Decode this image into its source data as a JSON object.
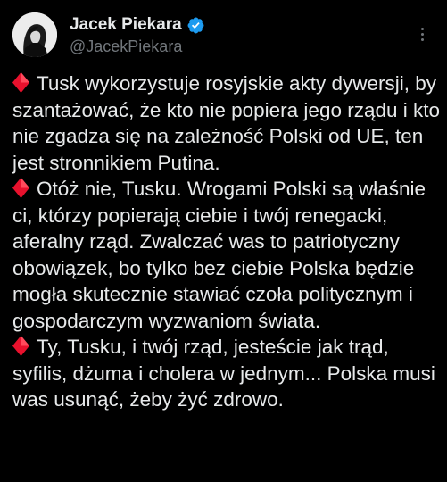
{
  "author": {
    "display_name": "Jacek Piekara",
    "handle": "@JacekPiekara",
    "verified_icon": "verified-badge-icon",
    "avatar_icon": "avatar-portrait"
  },
  "menu_icon": "more-options-icon",
  "bullet_icon": "red-diamond-icon",
  "colors": {
    "background": "#000000",
    "text": "#e7e9ea",
    "secondary_text": "#71767b",
    "verified": "#1d9bf0",
    "bullet": "#e8112d"
  },
  "tweet": {
    "paragraphs": [
      "Tusk wykorzystuje rosyjskie akty dywersji, by szantażować, że kto nie popiera jego rządu i kto nie zgadza się na zależność Polski od UE, ten jest stronnikiem Putina.",
      "Otóż nie, Tusku. Wrogami Polski są właśnie ci, którzy popierają ciebie i twój renegacki, aferalny rząd. Zwalczać was to patriotyczny obowiązek, bo tylko bez ciebie Polska będzie mogła skutecznie stawiać czoła politycznym i gospodarczym wyzwaniom świata.",
      "Ty, Tusku, i twój rząd, jesteście jak trąd, syfilis, dżuma i cholera w jednym... Polska musi was usunąć, żeby żyć zdrowo."
    ]
  }
}
